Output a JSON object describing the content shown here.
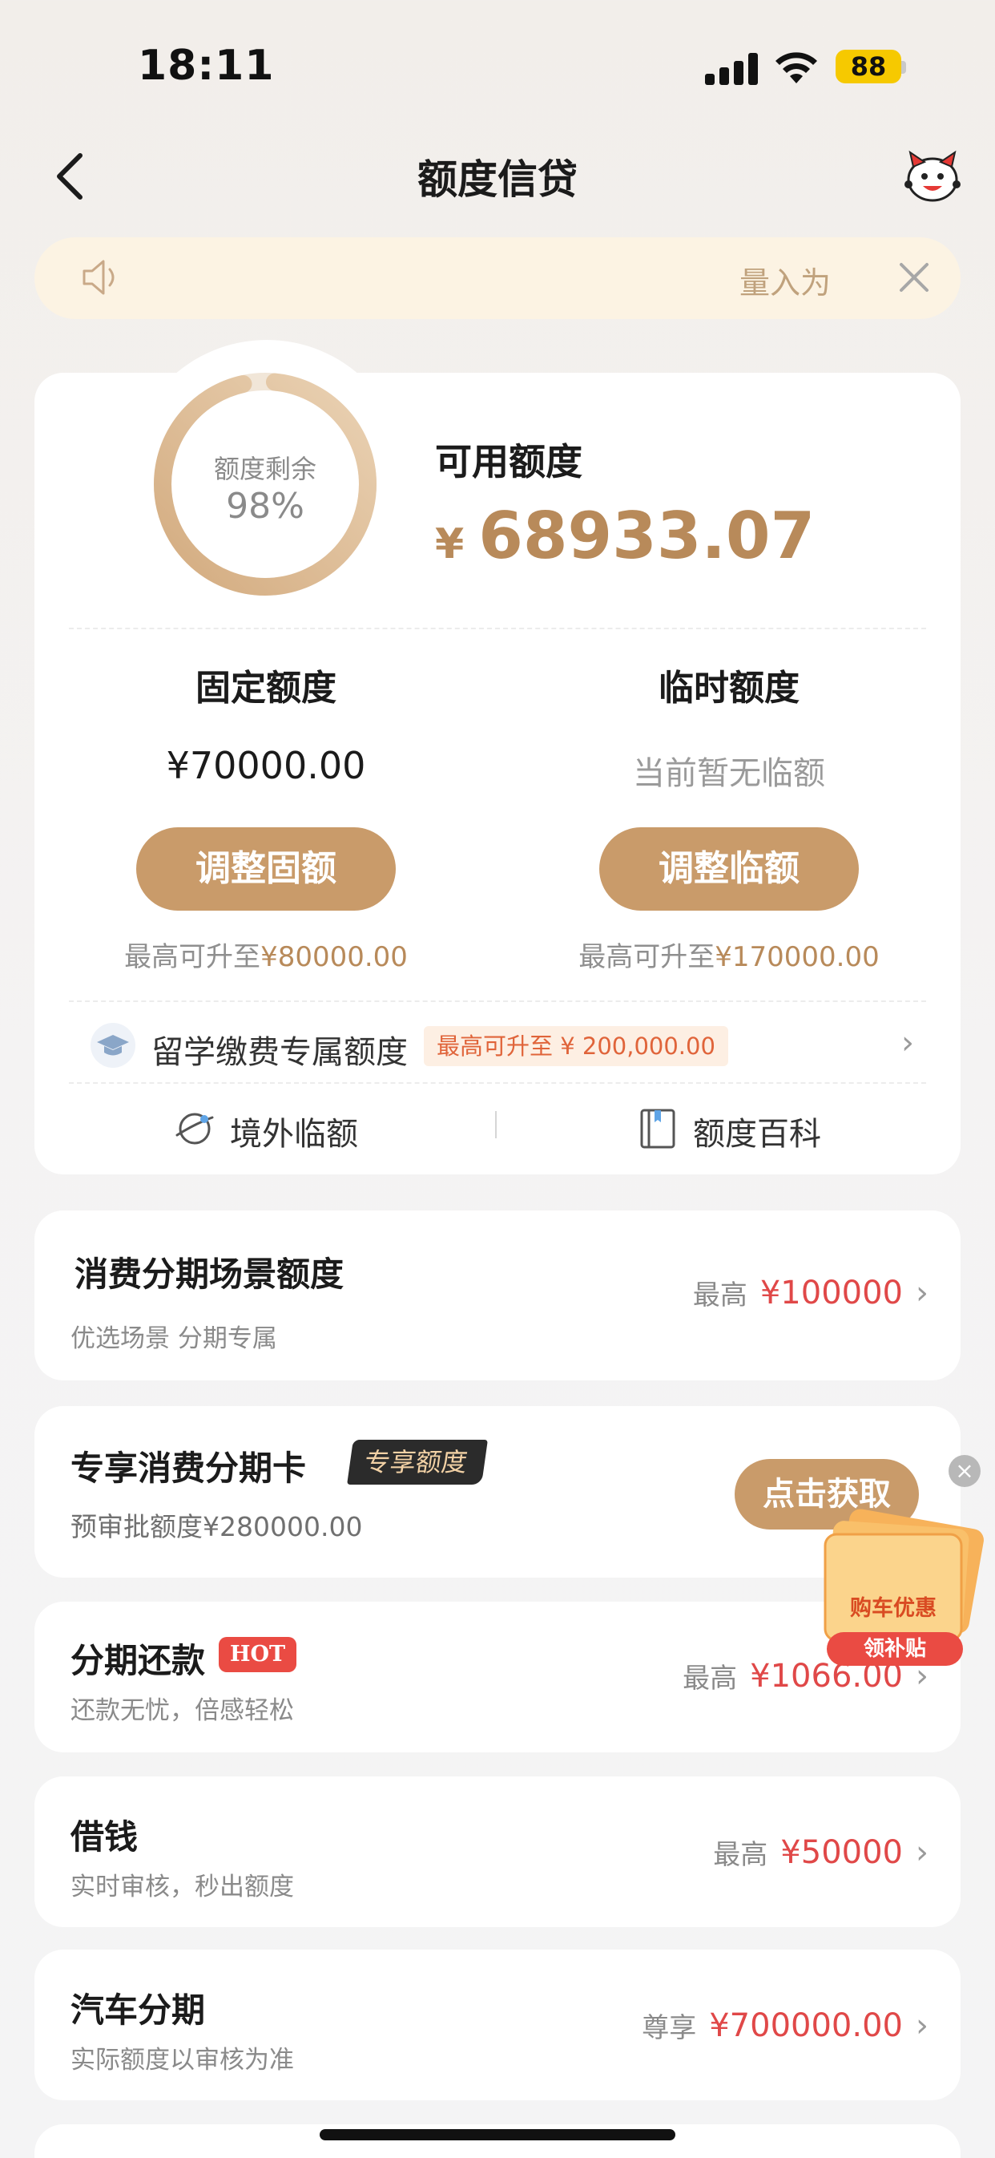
{
  "status": {
    "time": "18:11",
    "battery": "88"
  },
  "nav": {
    "title": "额度信贷"
  },
  "notice": {
    "text": "量入为"
  },
  "credit": {
    "ring_label": "额度剩余",
    "ring_value": "98%",
    "ring_fraction": 0.98,
    "available_label": "可用额度",
    "currency": "¥",
    "available_amount": "68933.07",
    "fixed": {
      "title": "固定额度",
      "value": "¥70000.00",
      "button": "调整固额",
      "note_prefix": "最高可升至",
      "note_value": "¥80000.00"
    },
    "temp": {
      "title": "临时额度",
      "value": "当前暂无临额",
      "button": "调整临额",
      "note_prefix": "最高可升至",
      "note_value": "¥170000.00"
    },
    "study": {
      "label": "留学缴费专属额度",
      "tag": "最高可升至 ¥ 200,000.00"
    },
    "overseas": "境外临额",
    "encyclopedia": "额度百科"
  },
  "cards": {
    "scene": {
      "title": "消费分期场景额度",
      "sub": "优选场景 分期专属",
      "right_label": "最高",
      "right_value": "¥100000"
    },
    "exclusive": {
      "title": "专享消费分期卡",
      "badge": "专享额度",
      "sub": "预审批额度¥280000.00",
      "button": "点击获取"
    },
    "repay": {
      "title": "分期还款",
      "badge": "HOT",
      "sub": "还款无忧，倍感轻松",
      "right_label": "最高",
      "right_value": "¥1066.00"
    },
    "borrow": {
      "title": "借钱",
      "sub": "实时审核，秒出额度",
      "right_label": "最高",
      "right_value": "¥50000"
    },
    "car": {
      "title": "汽车分期",
      "sub": "实际额度以审核为准",
      "right_label": "尊享",
      "right_value": "¥700000.00"
    }
  },
  "promo": {
    "title": "购车优惠",
    "button": "领补贴"
  },
  "colors": {
    "accent": "#c99b6a",
    "accent_text": "#b88a5a",
    "price_red": "#e04848",
    "notice_bg": "#fcf3e3"
  }
}
